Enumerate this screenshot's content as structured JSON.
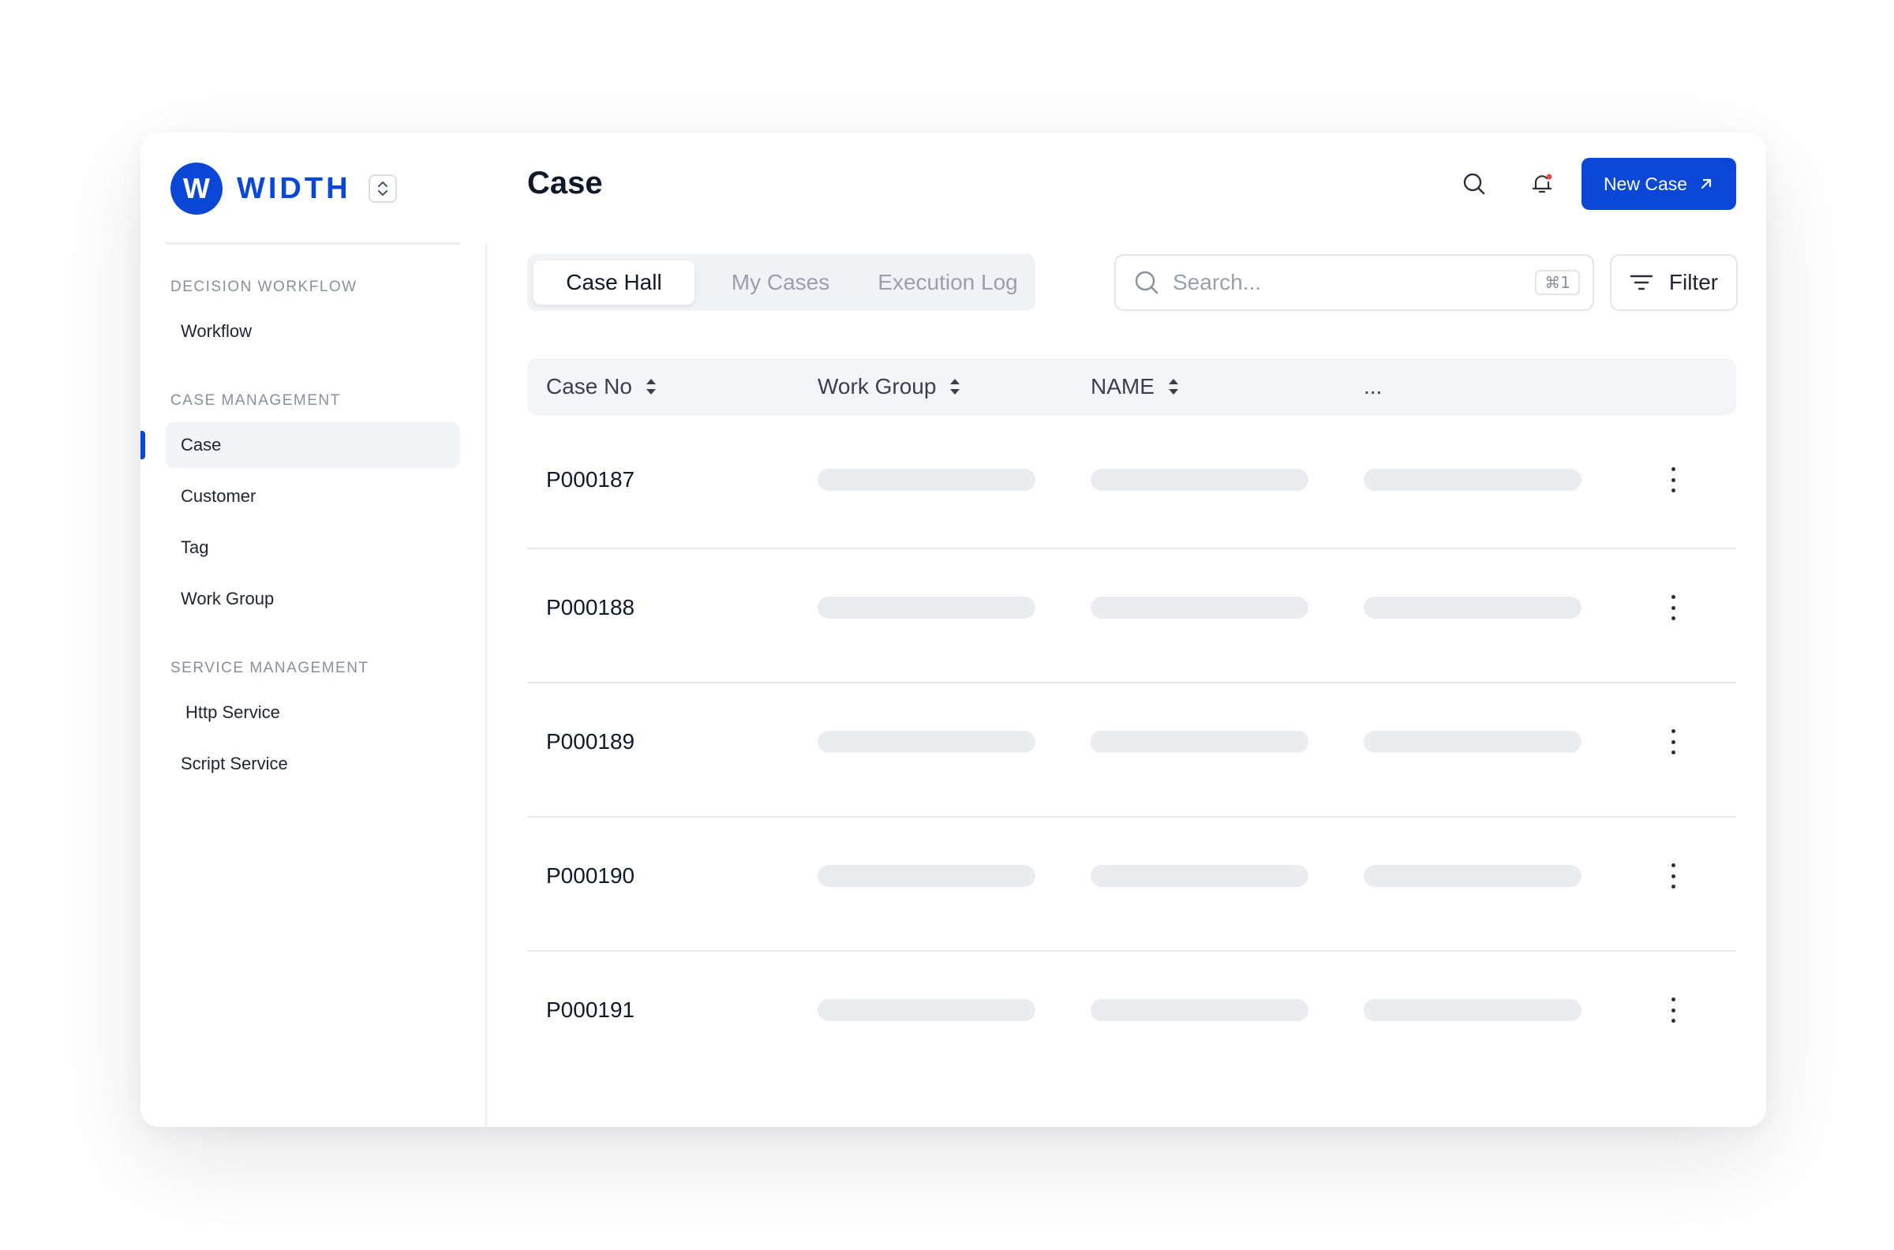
{
  "brand": {
    "logo_letter": "W",
    "name": "WIDTH",
    "color": "#0b47d6"
  },
  "sidebar": {
    "sections": [
      {
        "title": "DECISION WORKFLOW",
        "items": [
          {
            "label": "Workflow"
          }
        ]
      },
      {
        "title": "CASE MANAGEMENT",
        "items": [
          {
            "label": "Case",
            "active": true
          },
          {
            "label": "Customer"
          },
          {
            "label": "Tag"
          },
          {
            "label": "Work Group"
          }
        ]
      },
      {
        "title": "SERVICE MANAGEMENT",
        "items": [
          {
            "label": "Http Service"
          },
          {
            "label": "Script Service"
          }
        ]
      }
    ]
  },
  "header": {
    "title": "Case",
    "search_icon": "search-icon",
    "notification_icon": "bell-icon",
    "notification_dot_color": "#e5484d",
    "primary_button": {
      "label": "New Case",
      "icon": "arrow-up-right-icon"
    }
  },
  "tabs": [
    {
      "label": "Case Hall",
      "active": true
    },
    {
      "label": "My Cases"
    },
    {
      "label": "Execution Log"
    }
  ],
  "search": {
    "placeholder": "Search...",
    "shortcut": "⌘1"
  },
  "filter": {
    "label": "Filter"
  },
  "table": {
    "columns": [
      {
        "label": "Case No",
        "sortable": true
      },
      {
        "label": "Work Group",
        "sortable": true
      },
      {
        "label": "NAME",
        "sortable": true
      },
      {
        "label": "..."
      }
    ],
    "rows": [
      {
        "case_no": "P000187"
      },
      {
        "case_no": "P000188"
      },
      {
        "case_no": "P000189"
      },
      {
        "case_no": "P000190"
      },
      {
        "case_no": "P000191"
      }
    ]
  }
}
